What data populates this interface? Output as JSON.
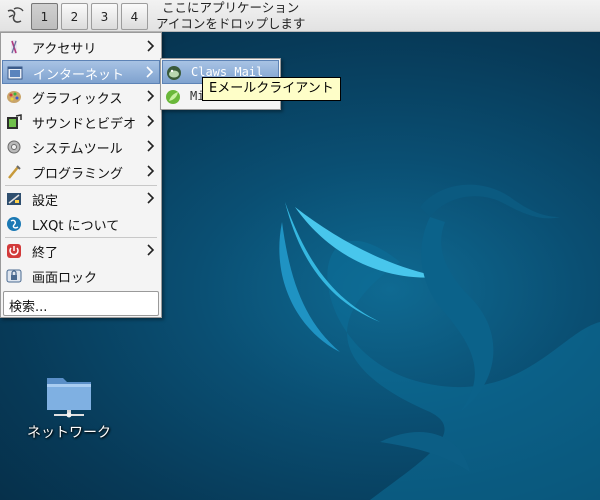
{
  "panel": {
    "desktops": [
      "1",
      "2",
      "3",
      "4"
    ],
    "active_desktop": "1",
    "drop_hint_line1": "ここにアプリケーション",
    "drop_hint_line2": "アイコンをドロップします"
  },
  "menu": {
    "items": [
      {
        "label": "アクセサリ",
        "icon": "accessories-icon",
        "submenu": true
      },
      {
        "label": "インターネット",
        "icon": "internet-icon",
        "submenu": true,
        "highlighted": true
      },
      {
        "label": "グラフィックス",
        "icon": "graphics-icon",
        "submenu": true
      },
      {
        "label": "サウンドとビデオ",
        "icon": "sound-video-icon",
        "submenu": true
      },
      {
        "label": "システムツール",
        "icon": "system-tools-icon",
        "submenu": true
      },
      {
        "label": "プログラミング",
        "icon": "programming-icon",
        "submenu": true
      },
      {
        "label": "設定",
        "icon": "settings-icon",
        "submenu": true
      },
      {
        "label": "LXQt について",
        "icon": "lxqt-about-icon",
        "submenu": false
      },
      {
        "label": "終了",
        "icon": "power-icon",
        "submenu": true
      },
      {
        "label": "画面ロック",
        "icon": "lock-screen-icon",
        "submenu": false
      }
    ],
    "search_label": "検索..."
  },
  "submenu": {
    "items": [
      {
        "label": "Claws Mail",
        "icon": "claws-mail-icon",
        "highlighted": true
      },
      {
        "label": "Mi",
        "icon": "midori-icon"
      }
    ]
  },
  "tooltip": {
    "text": "Eメールクライアント"
  },
  "desktop_icons": [
    {
      "label": "ネットワーク",
      "icon": "network-folder-icon"
    }
  ],
  "colors": {
    "highlight": "#8fb0d8",
    "desktop_bg": "#0a4f73",
    "tooltip_bg": "#fefec8"
  }
}
